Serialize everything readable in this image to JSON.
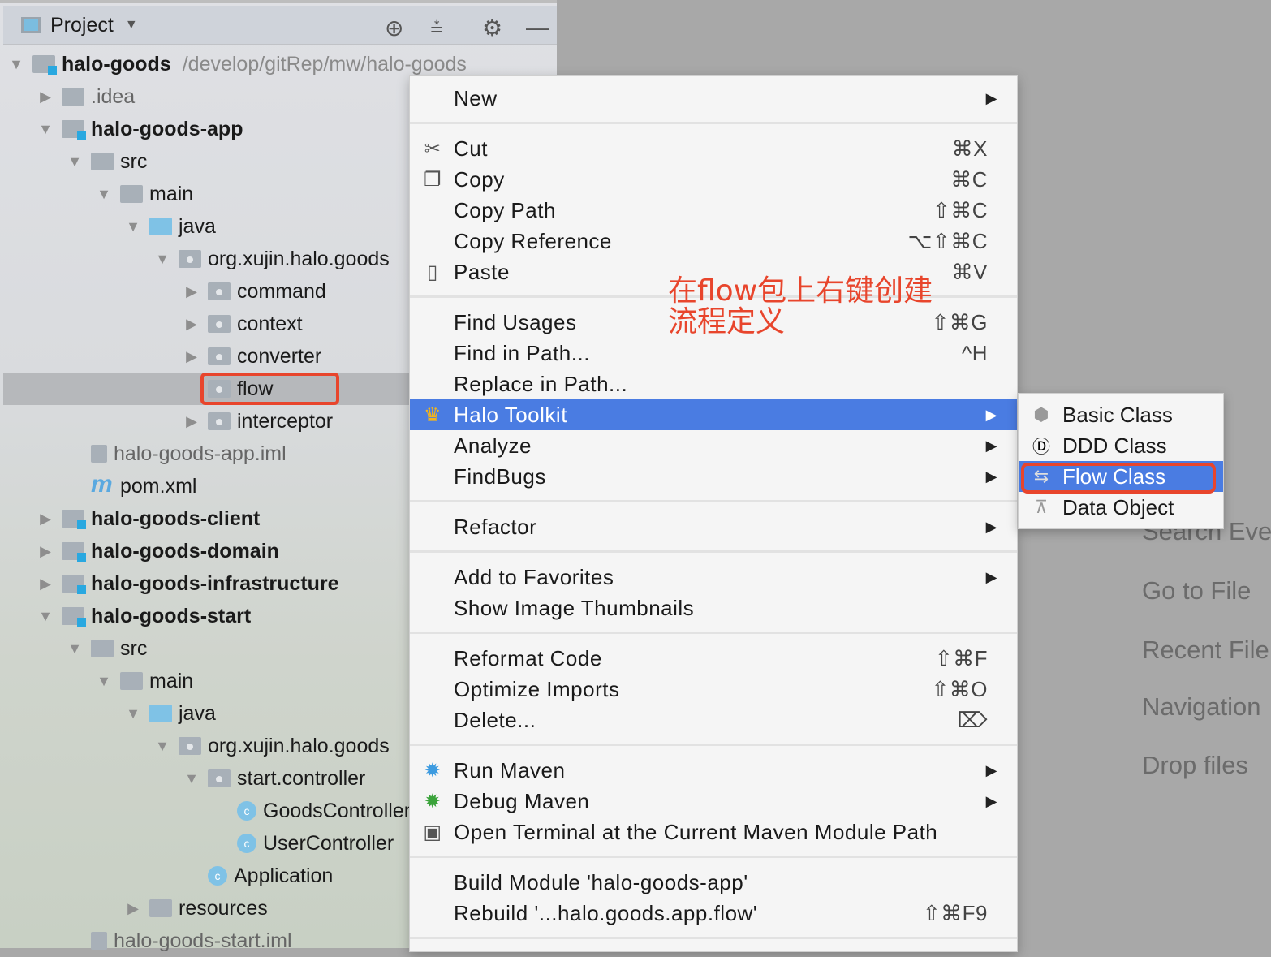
{
  "project_panel": {
    "title": "Project",
    "header_icons": [
      "locate-icon",
      "collapse-all-icon",
      "gear-icon",
      "minimize-icon"
    ],
    "tree": [
      {
        "level": 0,
        "arrow": "down",
        "icon": "module",
        "label": "halo-goods",
        "bold": true,
        "path": "/develop/gitRep/mw/halo-goods"
      },
      {
        "level": 1,
        "arrow": "right",
        "icon": "folder",
        "label": ".idea",
        "dim": true
      },
      {
        "level": 1,
        "arrow": "down",
        "icon": "module",
        "label": "halo-goods-app",
        "bold": true
      },
      {
        "level": 2,
        "arrow": "down",
        "icon": "folder",
        "label": "src"
      },
      {
        "level": 3,
        "arrow": "down",
        "icon": "folder",
        "label": "main"
      },
      {
        "level": 4,
        "arrow": "down",
        "icon": "folder-blue",
        "label": "java"
      },
      {
        "level": 5,
        "arrow": "down",
        "icon": "package",
        "label": "org.xujin.halo.goods"
      },
      {
        "level": 6,
        "arrow": "right",
        "icon": "package",
        "label": "command"
      },
      {
        "level": 6,
        "arrow": "right",
        "icon": "package",
        "label": "context"
      },
      {
        "level": 6,
        "arrow": "right",
        "icon": "package",
        "label": "converter"
      },
      {
        "level": 6,
        "arrow": "none",
        "icon": "package",
        "label": "flow",
        "selected": true
      },
      {
        "level": 6,
        "arrow": "right",
        "icon": "package",
        "label": "interceptor"
      },
      {
        "level": 2,
        "arrow": "none",
        "icon": "iml",
        "label": "halo-goods-app.iml",
        "dim": true
      },
      {
        "level": 2,
        "arrow": "none",
        "icon": "maven",
        "label": "pom.xml"
      },
      {
        "level": 1,
        "arrow": "right",
        "icon": "module",
        "label": "halo-goods-client",
        "bold": true
      },
      {
        "level": 1,
        "arrow": "right",
        "icon": "module",
        "label": "halo-goods-domain",
        "bold": true
      },
      {
        "level": 1,
        "arrow": "right",
        "icon": "module",
        "label": "halo-goods-infrastructure",
        "bold": true
      },
      {
        "level": 1,
        "arrow": "down",
        "icon": "module",
        "label": "halo-goods-start",
        "bold": true
      },
      {
        "level": 2,
        "arrow": "down",
        "icon": "folder",
        "label": "src"
      },
      {
        "level": 3,
        "arrow": "down",
        "icon": "folder",
        "label": "main"
      },
      {
        "level": 4,
        "arrow": "down",
        "icon": "folder-blue",
        "label": "java"
      },
      {
        "level": 5,
        "arrow": "down",
        "icon": "package",
        "label": "org.xujin.halo.goods"
      },
      {
        "level": 6,
        "arrow": "down",
        "icon": "package",
        "label": "start.controller"
      },
      {
        "level": 7,
        "arrow": "none",
        "icon": "class",
        "label": "GoodsController"
      },
      {
        "level": 7,
        "arrow": "none",
        "icon": "class",
        "label": "UserController"
      },
      {
        "level": 6,
        "arrow": "none",
        "icon": "class",
        "label": "Application"
      },
      {
        "level": 4,
        "arrow": "right",
        "icon": "folder",
        "label": "resources"
      },
      {
        "level": 2,
        "arrow": "none",
        "icon": "iml",
        "label": "halo-goods-start.iml",
        "dim": true
      }
    ]
  },
  "context_menu": [
    {
      "label": "New",
      "submenu": true
    },
    {
      "sep": true
    },
    {
      "label": "Cut",
      "shortcut": "⌘X",
      "icon": "scissors-icon",
      "glyph": "✂"
    },
    {
      "label": "Copy",
      "shortcut": "⌘C",
      "icon": "copy-icon",
      "glyph": "❐"
    },
    {
      "label": "Copy Path",
      "shortcut": "⇧⌘C"
    },
    {
      "label": "Copy Reference",
      "shortcut": "⌥⇧⌘C"
    },
    {
      "label": "Paste",
      "shortcut": "⌘V",
      "icon": "clipboard-icon",
      "glyph": "▯"
    },
    {
      "sep": true
    },
    {
      "label": "Find Usages",
      "shortcut": "⇧⌘G"
    },
    {
      "label": "Find in Path...",
      "shortcut": "^H"
    },
    {
      "label": "Replace in Path..."
    },
    {
      "label": "Halo Toolkit",
      "submenu": true,
      "highlighted": true,
      "icon": "crown-icon",
      "glyph": "♛"
    },
    {
      "label": "Analyze",
      "submenu": true
    },
    {
      "label": "FindBugs",
      "submenu": true
    },
    {
      "sep": true
    },
    {
      "label": "Refactor",
      "submenu": true
    },
    {
      "sep": true
    },
    {
      "label": "Add to Favorites",
      "submenu": true
    },
    {
      "label": "Show Image Thumbnails"
    },
    {
      "sep": true
    },
    {
      "label": "Reformat Code",
      "shortcut": "⇧⌘F"
    },
    {
      "label": "Optimize Imports",
      "shortcut": "⇧⌘O"
    },
    {
      "label": "Delete...",
      "shortcut": "⌦"
    },
    {
      "sep": true
    },
    {
      "label": "Run Maven",
      "submenu": true,
      "icon": "maven-gear-icon",
      "glyph": "✹"
    },
    {
      "label": "Debug Maven",
      "submenu": true,
      "icon": "maven-debug-icon",
      "glyph": "✹"
    },
    {
      "label": "Open Terminal at the Current Maven Module Path",
      "icon": "terminal-icon",
      "glyph": "▣"
    },
    {
      "sep": true
    },
    {
      "label": "Build Module 'halo-goods-app'"
    },
    {
      "label": "Rebuild '...halo.goods.app.flow'",
      "shortcut": "⇧⌘F9"
    },
    {
      "sep": true
    }
  ],
  "submenu": [
    {
      "label": "Basic Class",
      "icon": "badge-icon",
      "glyph": "⬢"
    },
    {
      "label": "DDD Class",
      "icon": "ddd-icon",
      "glyph": "Ⓓ"
    },
    {
      "label": "Flow Class",
      "icon": "flow-icon",
      "glyph": "⇆",
      "highlighted": true
    },
    {
      "label": "Data Object",
      "icon": "hierarchy-icon",
      "glyph": "⊼"
    }
  ],
  "annotation": {
    "line1": "在flow包上右键创建",
    "line2": "流程定义"
  },
  "welcome_hints": [
    "Search Eve",
    "Go to File",
    "Recent File",
    "Navigation",
    "Drop files"
  ],
  "colors": {
    "highlight": "#4a7ce2",
    "annotation": "#e8452c"
  }
}
